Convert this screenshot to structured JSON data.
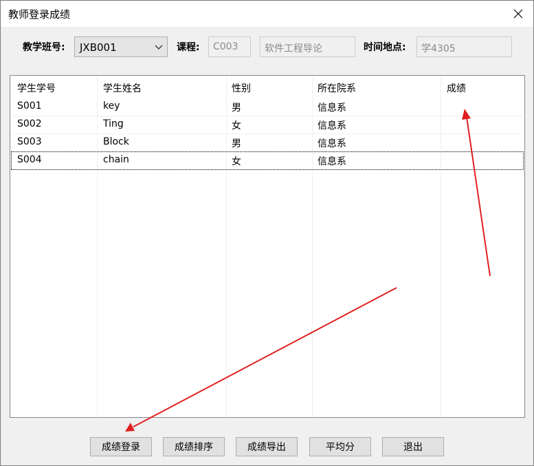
{
  "window": {
    "title": "教师登录成绩"
  },
  "filters": {
    "class_label": "教学班号:",
    "class_value": "JXB001",
    "course_label": "课程:",
    "course_code": "C003",
    "course_name": "软件工程导论",
    "time_place_label": "时间地点:",
    "time_place_value": "学4305"
  },
  "table": {
    "columns": [
      "学生学号",
      "学生姓名",
      "性别",
      "所在院系",
      "成绩"
    ],
    "rows": [
      [
        "S001",
        "key",
        "男",
        "信息系",
        ""
      ],
      [
        "S002",
        "Ting",
        "女",
        "信息系",
        ""
      ],
      [
        "S003",
        "Block",
        "男",
        "信息系",
        ""
      ],
      [
        "S004",
        "chain",
        "女",
        "信息系",
        ""
      ]
    ],
    "focused_row": 3
  },
  "buttons": {
    "enter_grades": "成绩登录",
    "sort_grades": "成绩排序",
    "export_grades": "成绩导出",
    "average": "平均分",
    "exit": "退出"
  },
  "annotation_color": "#e02020"
}
